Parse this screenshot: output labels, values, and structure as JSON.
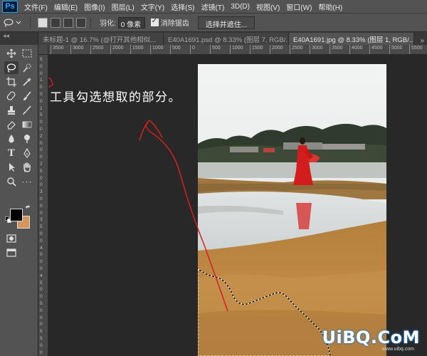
{
  "app": {
    "logo": "Ps",
    "menu": [
      "文件(F)",
      "编辑(E)",
      "图像(I)",
      "图层(L)",
      "文字(Y)",
      "选择(S)",
      "滤镜(T)",
      "3D(D)",
      "视图(V)",
      "窗口(W)",
      "帮助(H)"
    ]
  },
  "options_bar": {
    "feather_label": "羽化:",
    "feather_value": "0 像素",
    "antialias_label": "消除锯齿",
    "antialias_checked": true,
    "select_mask_button": "选择并遮住..."
  },
  "tabs": [
    {
      "label": "未标题-1 @ 16.7% (@打开其他相似...",
      "active": false
    },
    {
      "label": "E40A1691.psd @ 8.33% (图层 7, RGB/...",
      "active": false
    },
    {
      "label": "E40A1691.jpg @ 8.33% (图层 1, RGB/...",
      "active": true
    }
  ],
  "tab_overflow": "»",
  "toolbar_header": "◂◂",
  "ruler_h": [
    "3500",
    "3000",
    "2500",
    "2000",
    "1500",
    "1000",
    "500",
    "0",
    "500",
    "1000",
    "1500",
    "2000",
    "2500",
    "3000",
    "3500",
    "4000",
    "4500",
    "5000",
    "5500"
  ],
  "ruler_v": [
    "5",
    "0",
    "0",
    "1",
    "0",
    "0",
    "0",
    "1",
    "5",
    "0",
    "0",
    "2",
    "0",
    "0",
    "0",
    "2",
    "5",
    "0",
    "0",
    "3",
    "0",
    "0",
    "0",
    "3",
    "5",
    "0",
    "0",
    "4",
    "0",
    "0",
    "0",
    "4",
    "5",
    "0",
    "0",
    "5",
    "0",
    "0",
    "0",
    "5",
    "5",
    "0",
    "0"
  ],
  "colors": {
    "foreground": "#000000",
    "background": "#d5955d"
  },
  "canvas": {
    "instruction": "套索工具勾选想取的部分。",
    "watermark": "UiBQ.CoM",
    "watermark_sub": "www.uibq.com"
  }
}
